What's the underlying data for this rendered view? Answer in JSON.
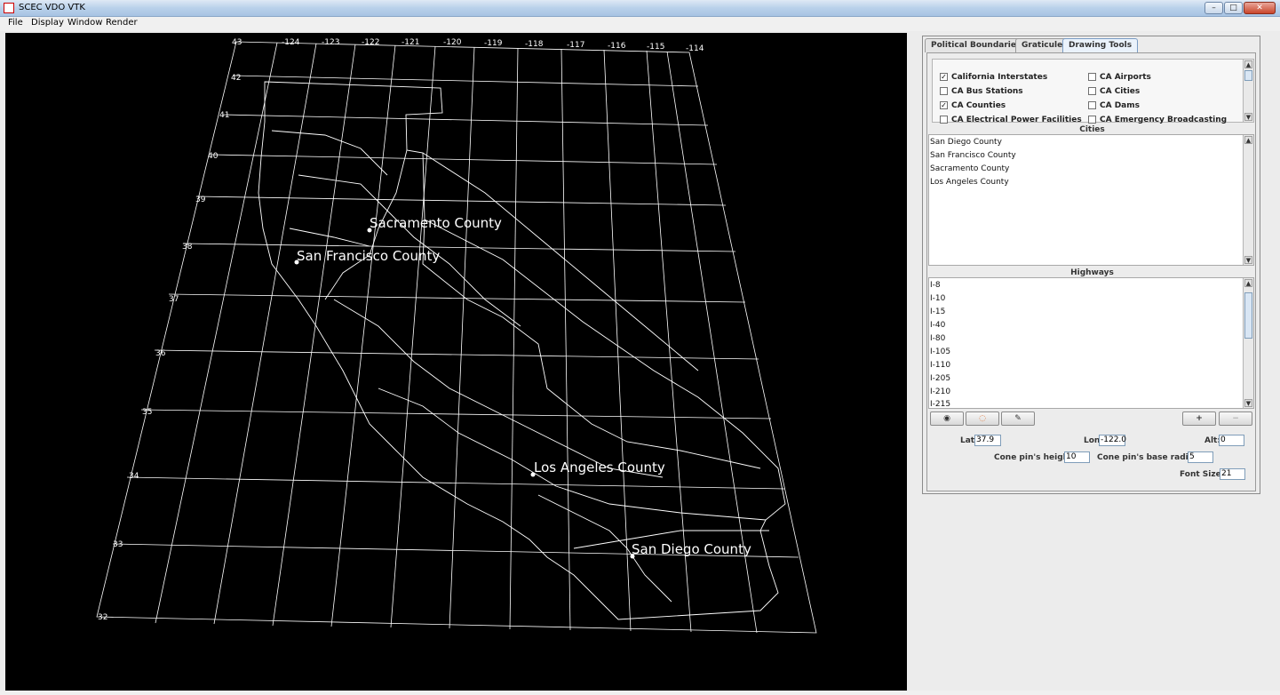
{
  "window": {
    "title": "SCEC VDO VTK",
    "minimize": "–",
    "maximize": "□",
    "close": "✕"
  },
  "menu": [
    "File",
    "Display",
    "Window",
    "Render"
  ],
  "map": {
    "top_labels": [
      "43",
      "-124",
      "-123",
      "-122",
      "-121",
      "-120",
      "-119",
      "-118",
      "-117",
      "-116",
      "-115",
      "-114"
    ],
    "left_labels": [
      "42",
      "41",
      "40",
      "39",
      "38",
      "37",
      "36",
      "35",
      "34",
      "33",
      "32"
    ],
    "places": [
      "Sacramento County",
      "San Francisco County",
      "Los Angeles County",
      "San Diego County"
    ]
  },
  "panel": {
    "tabs": [
      "Political Boundaries",
      "Graticule",
      "Drawing Tools"
    ],
    "active_tab": "Drawing Tools",
    "layers": [
      {
        "label": "California Interstates",
        "checked": true
      },
      {
        "label": "CA Airports",
        "checked": false
      },
      {
        "label": "CA Bus Stations",
        "checked": false
      },
      {
        "label": "CA Cities",
        "checked": false
      },
      {
        "label": "CA Counties",
        "checked": true
      },
      {
        "label": "CA Dams",
        "checked": false
      },
      {
        "label": "CA Electrical Power Facilities",
        "checked": false
      },
      {
        "label": "CA Emergency Broadcasting",
        "checked": false
      }
    ],
    "cities_label": "Cities",
    "cities": [
      "San Diego County",
      "San Francisco County",
      "Sacramento County",
      "Los Angeles County"
    ],
    "highways_label": "Highways",
    "highways": [
      "I-8",
      "I-10",
      "I-15",
      "I-40",
      "I-80",
      "I-105",
      "I-110",
      "I-205",
      "I-210",
      "I-215"
    ],
    "buttons": {
      "visibility": "eye-icon",
      "color": "color-wheel-icon",
      "edit": "edit-icon",
      "add": "+",
      "remove": "−"
    },
    "fields": {
      "lat_label": "Lat:",
      "lat_value": "37.9",
      "lon_label": "Lon:",
      "lon_value": "-122.0",
      "alt_label": "Alt:",
      "alt_value": "0",
      "cone_height_label": "Cone pin's height:",
      "cone_height_value": "10",
      "cone_radius_label": "Cone pin's base radius:",
      "cone_radius_value": "5",
      "font_size_label": "Font Size:",
      "font_size_value": "21"
    }
  }
}
